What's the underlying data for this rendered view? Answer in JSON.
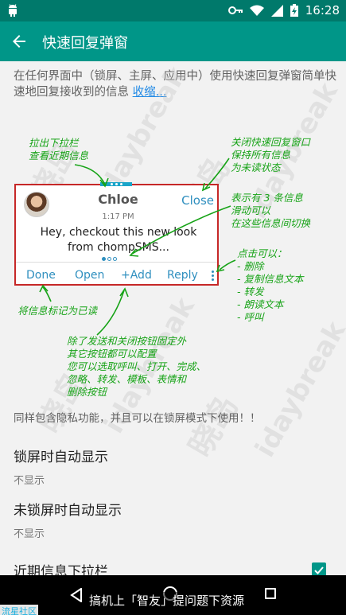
{
  "status": {
    "time": "16:28"
  },
  "appbar": {
    "title": "快速回复弹窗"
  },
  "intro": {
    "text": "在任何界面中（锁屏、主屏、应用中）使用快速回复弹窗简单快速地回复接收到的信息",
    "link": "收缩..."
  },
  "watermark": {
    "cn": "晓岛",
    "en": "idaybreak"
  },
  "card": {
    "name": "Chloe",
    "close": "Close",
    "time": "1:17 PM",
    "message": "Hey, checkout this new look from chompSMS...",
    "actions": {
      "done": "Done",
      "open": "Open",
      "add": "+Add",
      "reply": "Reply"
    }
  },
  "notes": {
    "pull_down": [
      "拉出下拉栏",
      "查看近期信息"
    ],
    "close_note": [
      "关闭快速回复窗口",
      "保持所有信息",
      "为未读状态"
    ],
    "swipe": [
      "表示有 3 条信息",
      "滑动可以",
      "在这些信息间切换"
    ],
    "menu": [
      "点击可以：",
      "- 删除",
      "- 复制信息文本",
      "- 转发",
      "- 朗读文本",
      "- 呼叫"
    ],
    "done": "将信息标记为已读",
    "config": [
      "除了发送和关闭按钮固定外",
      "其它按钮都可以配置",
      "您可以选取呼叫、打开、完成、",
      "忽略、转发、模板、表情和",
      "删除按钮"
    ]
  },
  "privacy": "同样包含隐私功能，并且可以在锁屏模式下使用！！",
  "prefs": [
    {
      "title": "锁屏时自动显示",
      "summary": "不显示"
    },
    {
      "title": "未锁屏时自动显示",
      "summary": "不显示"
    },
    {
      "title": "近期信息下拉栏",
      "summary": ""
    }
  ],
  "overlay": {
    "caption": "搞机上「智友」提问题下资源",
    "community": "流星社区"
  },
  "colors": {
    "accent": "#009688",
    "status_bar": "#00796b",
    "annotation": "#17a317",
    "card_border": "#c62828",
    "link": "#1e88e5"
  }
}
